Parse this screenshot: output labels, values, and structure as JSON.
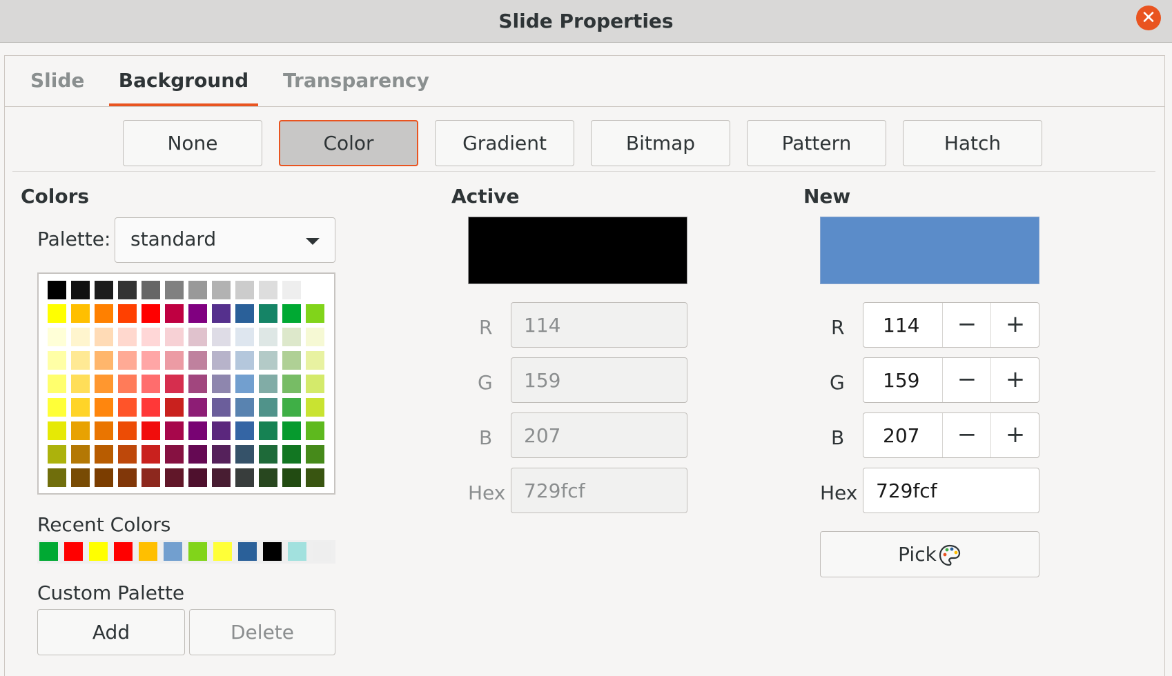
{
  "window": {
    "title": "Slide Properties"
  },
  "tabs": [
    {
      "label": "Slide"
    },
    {
      "label": "Background"
    },
    {
      "label": "Transparency"
    }
  ],
  "fill_types": [
    {
      "label": "None"
    },
    {
      "label": "Color"
    },
    {
      "label": "Gradient"
    },
    {
      "label": "Bitmap"
    },
    {
      "label": "Pattern"
    },
    {
      "label": "Hatch"
    }
  ],
  "colors": {
    "title": "Colors",
    "palette_label": "Palette:",
    "palette_value": "standard",
    "grid": [
      [
        "#000000",
        "#111111",
        "#1c1c1c",
        "#333333",
        "#666666",
        "#808080",
        "#999999",
        "#b2b2b2",
        "#cccccc",
        "#dddddd",
        "#eeeeee",
        "#ffffff"
      ],
      [
        "#ffff00",
        "#ffbf00",
        "#ff8000",
        "#ff4000",
        "#ff0000",
        "#bf0041",
        "#800080",
        "#55308d",
        "#2a6099",
        "#158466",
        "#00a933",
        "#81d41a"
      ],
      [
        "#ffffd7",
        "#fff5ce",
        "#ffdbb6",
        "#ffd8ce",
        "#ffd7d7",
        "#f7d1d5",
        "#e0c2cd",
        "#dedce6",
        "#dee6ef",
        "#dee7e5",
        "#dde8cb",
        "#f6f9d4"
      ],
      [
        "#ffffa6",
        "#ffe994",
        "#ffb66c",
        "#ffaa95",
        "#ffa6a6",
        "#ec9ba4",
        "#bf819e",
        "#b7b3ca",
        "#b4c7dc",
        "#b3cac7",
        "#afd095",
        "#e8f2a1"
      ],
      [
        "#ffff6d",
        "#ffde59",
        "#ff972f",
        "#ff7b59",
        "#ff6d6d",
        "#d62e4e",
        "#a1467e",
        "#8e86ae",
        "#729fcf",
        "#81aca6",
        "#77bc65",
        "#d4ea6b"
      ],
      [
        "#ffff38",
        "#ffd428",
        "#ff860d",
        "#ff5429",
        "#ff3838",
        "#c9211e",
        "#8d1d75",
        "#6b5e9b",
        "#5983b0",
        "#50938a",
        "#3faf46",
        "#c9e331"
      ],
      [
        "#e6e905",
        "#e8a202",
        "#ea7500",
        "#ed4c05",
        "#f10d0c",
        "#a7074b",
        "#780373",
        "#5b277d",
        "#3465a4",
        "#168253",
        "#069a2e",
        "#5eb91e"
      ],
      [
        "#acb20c",
        "#b47804",
        "#b85c00",
        "#be480a",
        "#c9211e",
        "#861141",
        "#650953",
        "#55215b",
        "#355269",
        "#1e6a39",
        "#127622",
        "#468a1a"
      ],
      [
        "#706e0c",
        "#784b04",
        "#7b3d00",
        "#813709",
        "#8d281e",
        "#611729",
        "#4e102d",
        "#481d32",
        "#383d3c",
        "#28471f",
        "#224b12",
        "#395511"
      ]
    ],
    "recent_label": "Recent Colors",
    "recent": [
      "#00a933",
      "#ff0000",
      "#ffff00",
      "#ff0000",
      "#ffbf00",
      "#729fcf",
      "#81d41a",
      "#ffff38",
      "#2a6099",
      "#000000",
      "#a2e1de",
      "#eeeeee"
    ],
    "custom_label": "Custom Palette",
    "add_label": "Add",
    "delete_label": "Delete"
  },
  "active": {
    "title": "Active",
    "color": "#000000",
    "r_label": "R",
    "r": "114",
    "g_label": "G",
    "g": "159",
    "b_label": "B",
    "b": "207",
    "hex_label": "Hex",
    "hex": "729fcf"
  },
  "new": {
    "title": "New",
    "color": "#5b8cc9",
    "r_label": "R",
    "r": "114",
    "g_label": "G",
    "g": "159",
    "b_label": "B",
    "b": "207",
    "hex_label": "Hex",
    "hex": "729fcf",
    "minus": "−",
    "plus": "+",
    "pick_label": "Pick"
  }
}
